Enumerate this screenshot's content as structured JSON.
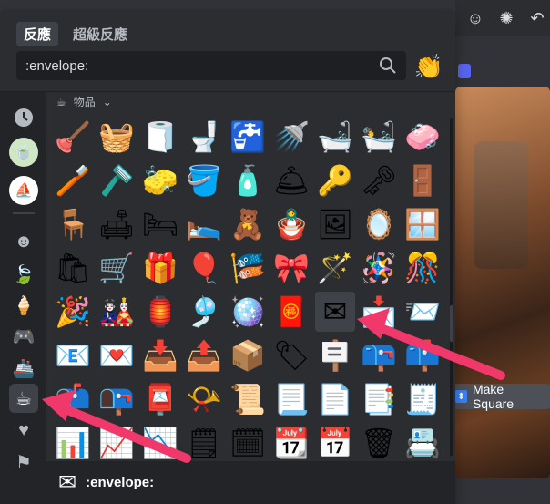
{
  "picker": {
    "tabs": [
      {
        "label": "反應",
        "active": true
      },
      {
        "label": "超級反應",
        "active": false
      }
    ],
    "search": {
      "value": ":envelope:"
    },
    "wave_emoji": "👏",
    "category_label": "物品",
    "sidebar_icons": [
      "🕒",
      "avatar1",
      "avatar2",
      "🙂",
      "🍃",
      "🍦",
      "🎮",
      "🚢",
      "☕",
      "♥",
      "🏳"
    ],
    "grid": [
      [
        "🪠",
        "🧺",
        "🧻",
        "🚽",
        "🚰",
        "🚿",
        "🛁",
        "🛀",
        "🧼"
      ],
      [
        "🪥",
        "🪒",
        "🧽",
        "🪣",
        "🧴",
        "🛎",
        "🔑",
        "🗝",
        "🚪"
      ],
      [
        "🪑",
        "🛋",
        "🛏",
        "🛌",
        "🧸",
        "🪆",
        "🖼",
        "🪞",
        "🪟"
      ],
      [
        "🛍",
        "🛒",
        "🎁",
        "🎈",
        "🎏",
        "🎀",
        "🪄",
        "🪅",
        "🎊"
      ],
      [
        "🎉",
        "🎎",
        "🏮",
        "🎐",
        "🪩",
        "🧧",
        "✉",
        "📩",
        "📨"
      ],
      [
        "📧",
        "💌",
        "📥",
        "📤",
        "📦",
        "🏷",
        "🪧",
        "📪",
        "📫"
      ],
      [
        "📬",
        "📭",
        "📮",
        "📯",
        "📜",
        "📃",
        "📄",
        "📑",
        "🧾"
      ],
      [
        "📊",
        "📈",
        "📉",
        "🗒",
        "🗓",
        "📆",
        "📅",
        "🗑",
        "📇"
      ]
    ],
    "footer": {
      "emoji": "✉",
      "label": ":envelope:"
    }
  },
  "background": {
    "make_square_label": "Make Square"
  },
  "colors": {
    "accent": "#5865f2",
    "arrow": "#f0386b",
    "panel": "#2b2d31"
  }
}
